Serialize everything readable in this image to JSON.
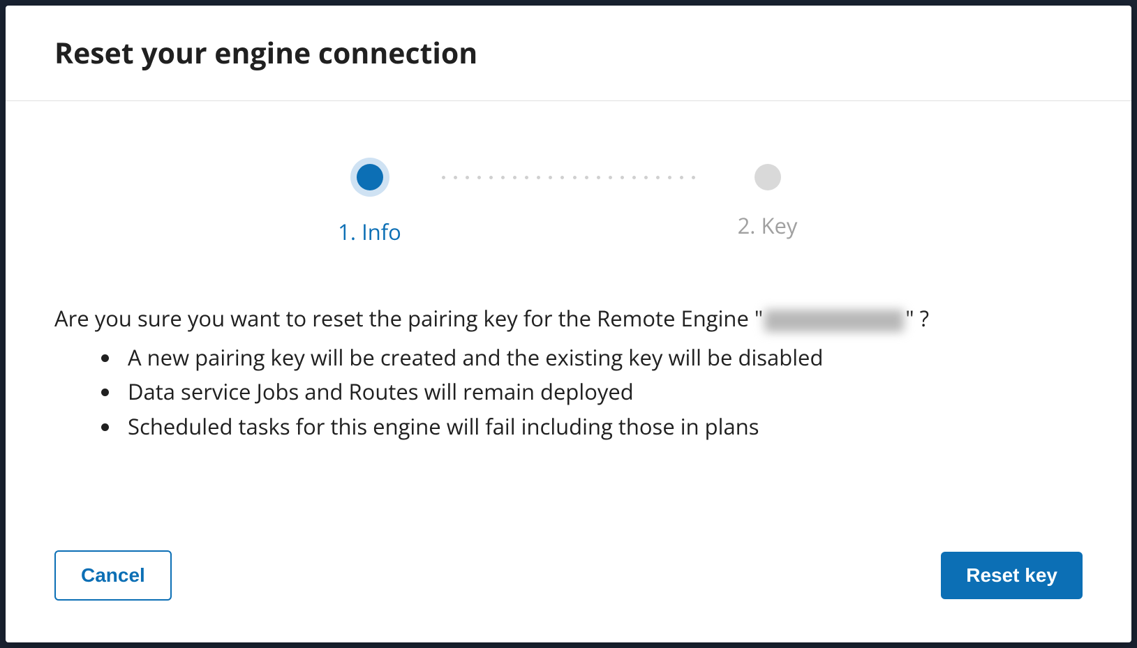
{
  "modal": {
    "title": "Reset your engine connection",
    "stepper": {
      "steps": [
        {
          "label": "1. Info",
          "active": true
        },
        {
          "label": "2. Key",
          "active": false
        }
      ]
    },
    "confirm": {
      "prefix": "Are you sure you want to reset the pairing key for the Remote Engine \"",
      "engine_name": "",
      "suffix": "\" ?"
    },
    "bullets": [
      "A new pairing key will be created and the existing key will be disabled",
      "Data service Jobs and Routes will remain deployed",
      "Scheduled tasks for this engine will fail including those in plans"
    ],
    "buttons": {
      "cancel": "Cancel",
      "reset": "Reset key"
    }
  },
  "colors": {
    "accent": "#0c6fb5",
    "inactive": "#d9d9d9",
    "text": "#202020",
    "muted": "#a0a0a0"
  }
}
